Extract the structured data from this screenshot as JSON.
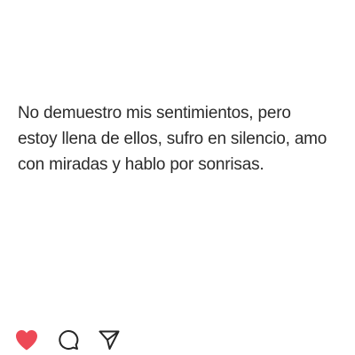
{
  "post": {
    "text_lines": [
      "No demuestro mis sentimientos, pero",
      "estoy llena de ellos, sufro en silencio, amo",
      "con miradas y hablo por sonrisas."
    ]
  },
  "actions": {
    "like": {
      "icon": "heart-icon",
      "state": "liked",
      "color": "#ed4956"
    },
    "comment": {
      "icon": "comment-bubble-icon",
      "color": "#262626"
    },
    "share": {
      "icon": "paper-plane-icon",
      "color": "#262626"
    }
  },
  "colors": {
    "background": "#ffffff",
    "text": "#2b2b2b"
  }
}
